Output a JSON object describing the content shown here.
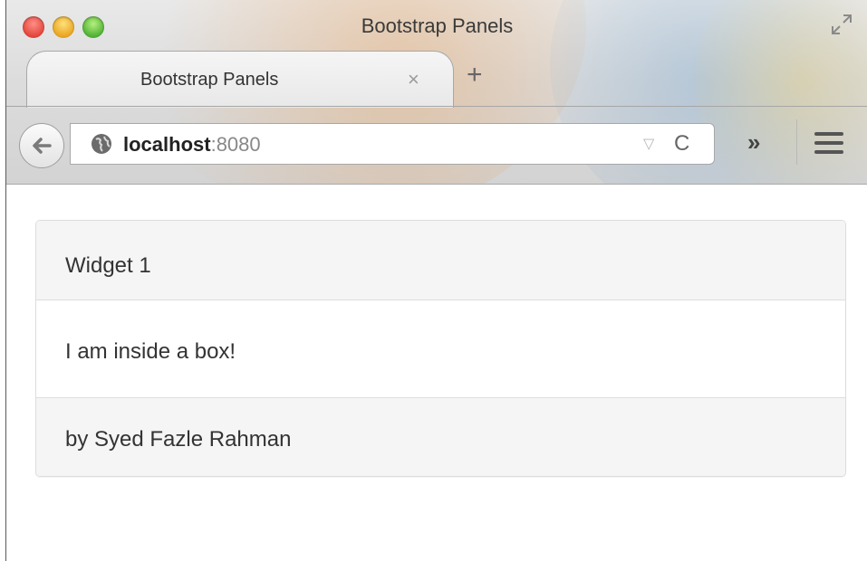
{
  "window": {
    "title": "Bootstrap Panels",
    "controls": [
      "close",
      "minimize",
      "zoom"
    ],
    "fullscreen_icon": "fullscreen-icon"
  },
  "tabs": [
    {
      "label": "Bootstrap Panels",
      "close_glyph": "×",
      "active": true
    }
  ],
  "new_tab_glyph": "+",
  "toolbar": {
    "back_icon": "back-arrow-icon",
    "url_host": "localhost",
    "url_port": ":8080",
    "dropmarker_glyph": "▽",
    "reload_glyph": "C",
    "overflow_glyph": "»",
    "menu_icon": "hamburger-menu-icon"
  },
  "panel": {
    "heading": "Widget 1",
    "body": "I am inside a box!",
    "footer": "by Syed Fazle Rahman"
  },
  "colors": {
    "panel_heading_bg": "#f5f5f5",
    "panel_border": "#dddddd",
    "text": "#333333"
  }
}
